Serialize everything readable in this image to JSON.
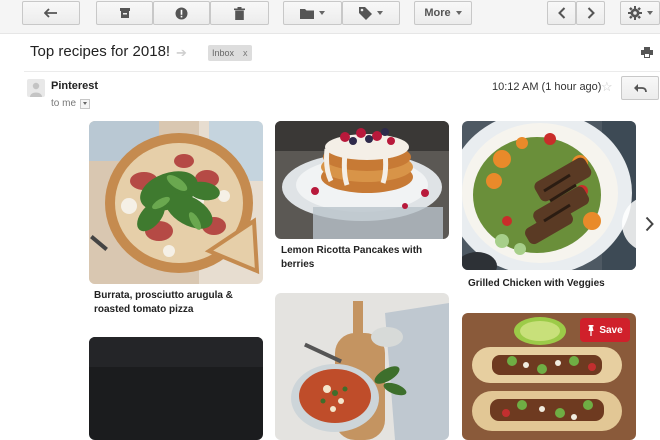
{
  "toolbar": {
    "more_label": "More"
  },
  "email": {
    "subject": "Top recipes for 2018!",
    "label": "Inbox",
    "label_close": "x",
    "sender": "Pinterest",
    "to": "to me",
    "time": "10:12 AM (1 hour ago)"
  },
  "cards": [
    {
      "title": "Burrata, prosciutto arugula & roasted tomato pizza"
    },
    {
      "title": "Lemon Ricotta Pancakes with berries"
    },
    {
      "title": "Grilled Chicken with Veggies"
    }
  ],
  "save_label": "Save",
  "icons": {
    "back": "arrow-left-icon",
    "archive": "archive-icon",
    "spam": "report-spam-icon",
    "delete": "trash-icon",
    "move": "folder-icon",
    "labels": "tag-icon",
    "prev": "chevron-left-icon",
    "next": "chevron-right-icon",
    "settings": "gear-icon",
    "print": "print-icon",
    "reply": "reply-icon",
    "star": "star-icon",
    "pin": "pin-icon"
  },
  "colors": {
    "save_red": "#d0202b",
    "toolbar_bg": "#f5f5f5"
  }
}
